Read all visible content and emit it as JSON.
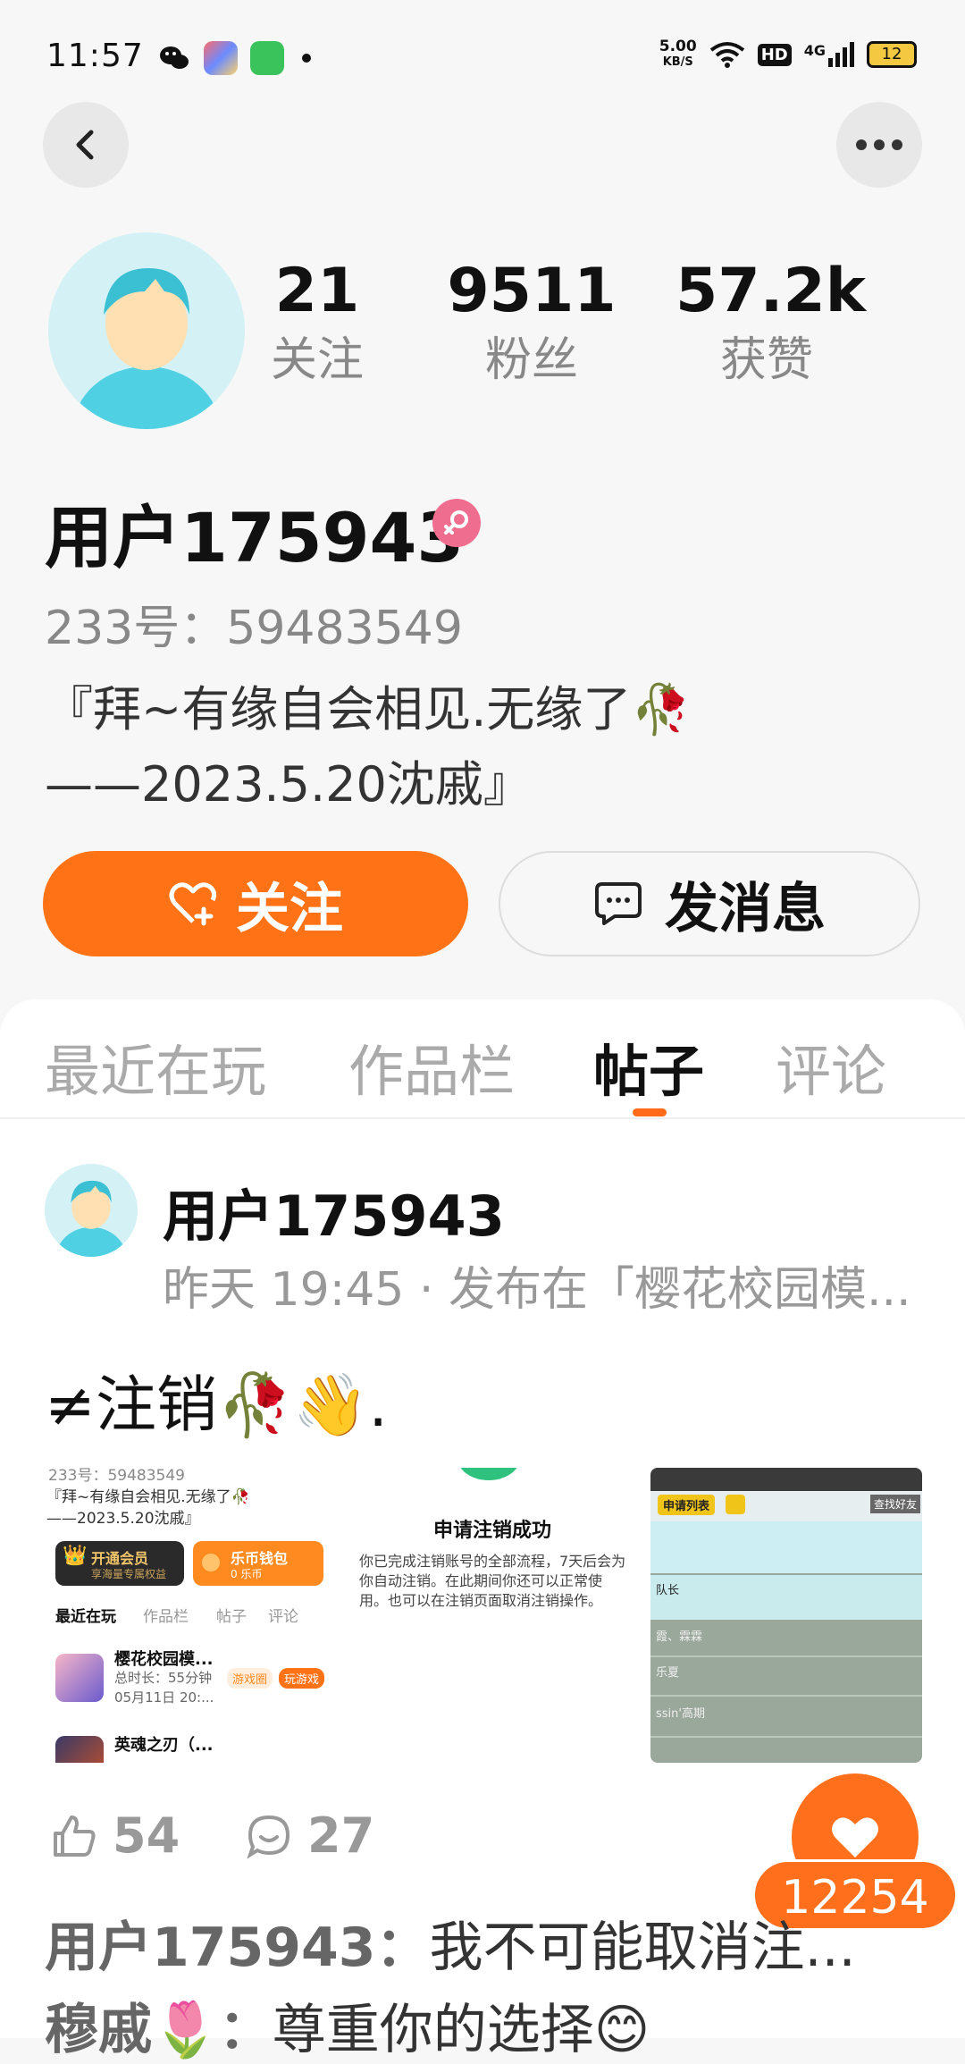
{
  "status_bar": {
    "time": "11:57",
    "net_speed_value": "5.00",
    "net_speed_unit": "KB/S",
    "hd": "HD",
    "network": "4G",
    "battery": "12"
  },
  "profile": {
    "following_count": "21",
    "following_label": "关注",
    "followers_count": "9511",
    "followers_label": "粉丝",
    "likes_count": "57.2k",
    "likes_label": "获赞",
    "username": "用户175943",
    "id_line": "233号：59483549",
    "bio_line1": "『拜~有缘自会相见.无缘了🥀",
    "bio_line2": "——2023.5.20沈戚』"
  },
  "actions": {
    "follow_label": "关注",
    "message_label": "发消息"
  },
  "tabs": [
    {
      "label": "最近在玩"
    },
    {
      "label": "作品栏"
    },
    {
      "label": "帖子"
    },
    {
      "label": "评论"
    }
  ],
  "post": {
    "author": "用户175943",
    "meta": "昨天 19:45 · 发布在「樱花校园模...",
    "title": "≠注销🥀👋.",
    "likes": "54",
    "comments": "27",
    "favorites": "12254",
    "comment1_user": "用户175943：",
    "comment1_text": "我不可能取消注...",
    "comment2_user": "穆戚🌷：",
    "comment2_text": "尊重你的选择😊"
  },
  "thumb1": {
    "line1": "233号：59483549",
    "line2": "『拜~有缘自会相见.无缘了🥀",
    "line3": "——2023.5.20沈戚』",
    "vip": "开通会员",
    "vip_sub": "享海量专属权益",
    "wallet": "乐币钱包",
    "wallet_sub": "0 乐币",
    "tab1": "最近在玩",
    "tab2": "作品栏",
    "tab3": "帖子",
    "tab4": "评论",
    "game1": "樱花校园模...",
    "game1_time": "总时长：55分钟",
    "game1_date": "05月11日 20:...",
    "game1_tag": "游戏圈",
    "game1_play": "玩游戏",
    "game2": "英魂之刃（..."
  },
  "thumb2": {
    "title": "申请注销成功",
    "body": "你已完成注销账号的全部流程，7天后会为你自动注销。在此期间你还可以正常使用。也可以在注销页面取消注销操作。"
  },
  "thumb3": {
    "btn": "申请列表",
    "right": "查找好友",
    "row1": "队长",
    "row2": "霞、霖霖",
    "row3": "乐夏",
    "row4": "ssin'高期"
  },
  "colors": {
    "accent": "#ff7316",
    "background": "#f7f7f7"
  }
}
